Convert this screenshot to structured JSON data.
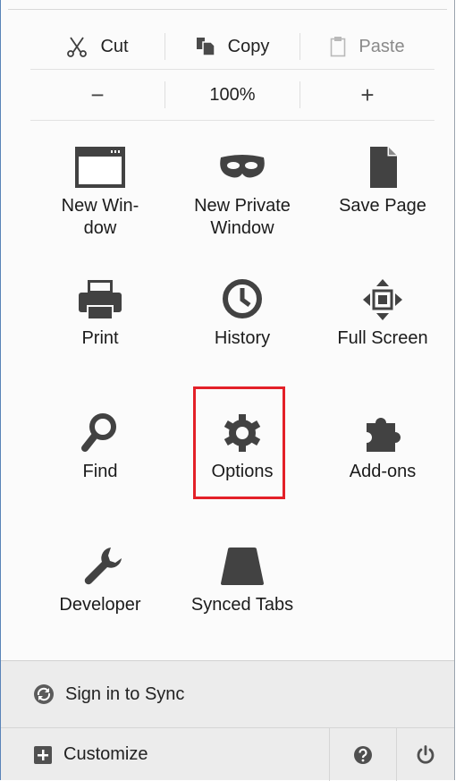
{
  "edit": {
    "cut_label": "Cut",
    "copy_label": "Copy",
    "paste_label": "Paste"
  },
  "zoom": {
    "minus_label": "−",
    "level": "100%",
    "plus_label": "+"
  },
  "items": {
    "new_window": "New Win-\ndow",
    "new_private_window": "New Private\nWindow",
    "save_page": "Save Page",
    "print": "Print",
    "history": "History",
    "full_screen": "Full Screen",
    "find": "Find",
    "options": "Options",
    "add_ons": "Add-ons",
    "developer": "Developer",
    "synced_tabs": "Synced Tabs"
  },
  "footer": {
    "sign_in_label": "Sign in to Sync",
    "customize_label": "Customize"
  },
  "colors": {
    "highlight": "#e32028",
    "icon": "#424242"
  }
}
